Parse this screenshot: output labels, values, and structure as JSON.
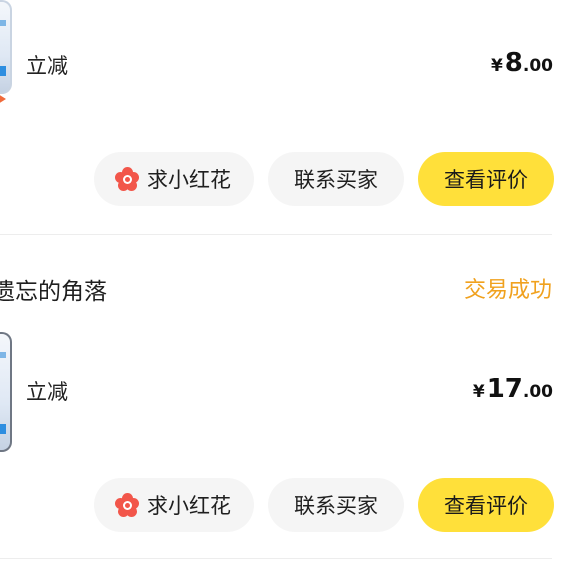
{
  "orders": [
    {
      "shop_name": "",
      "status": "",
      "item_title": "立减",
      "price": {
        "currency": "¥",
        "integer": "8",
        "decimal": ".00"
      },
      "actions": {
        "flower": "求小红花",
        "contact": "联系买家",
        "review": "查看评价"
      }
    },
    {
      "shop_name": "遗忘的角落",
      "status": "交易成功",
      "item_title": "立减",
      "price": {
        "currency": "¥",
        "integer": "17",
        "decimal": ".00"
      },
      "actions": {
        "flower": "求小红花",
        "contact": "联系买家",
        "review": "查看评价"
      }
    }
  ],
  "colors": {
    "status": "#f0a11e",
    "primary_button": "#ffe03a",
    "secondary_button": "#f5f5f5",
    "flower_icon": "#f2564a"
  },
  "icons": {
    "flower": "flower-icon"
  }
}
